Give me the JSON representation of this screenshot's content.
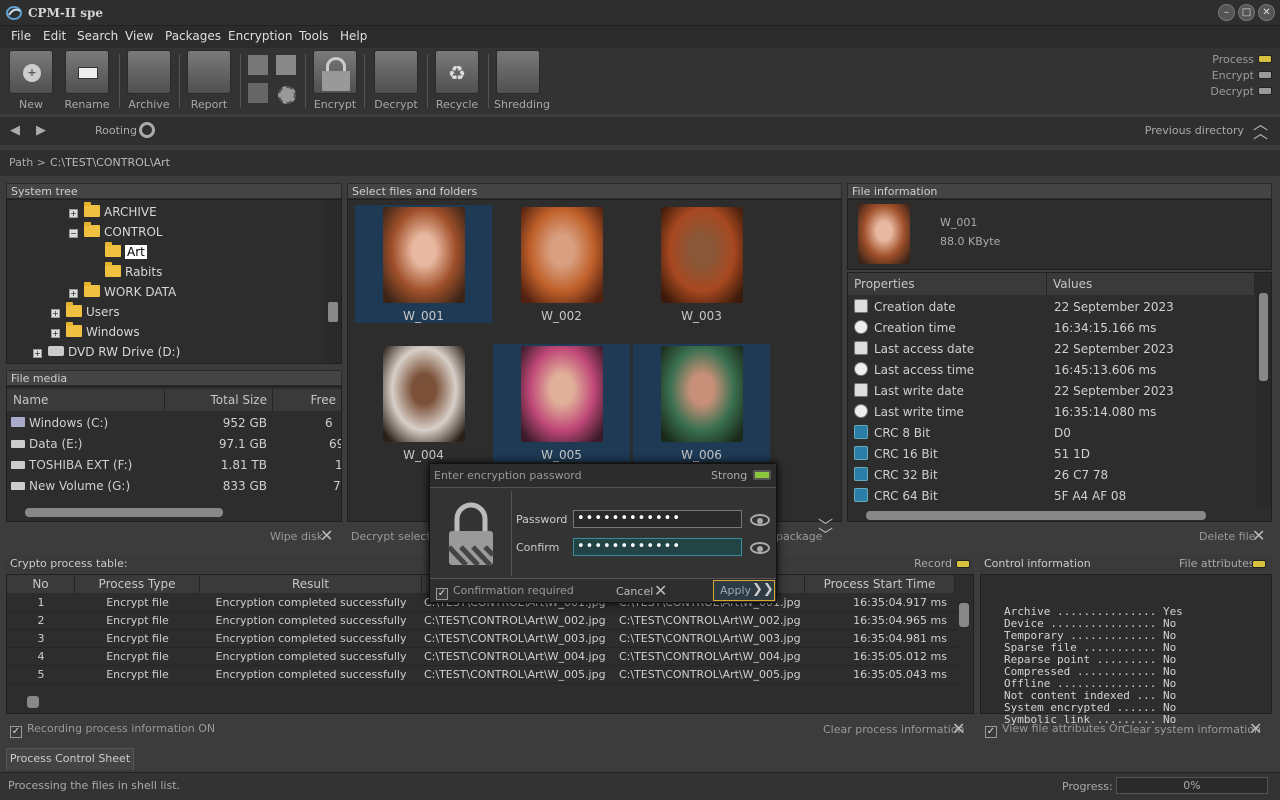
{
  "app": {
    "title": "CPM-II spe"
  },
  "menu": [
    "File",
    "Edit",
    "Search",
    "View",
    "Packages",
    "Encryption",
    "Tools",
    "Help"
  ],
  "toolbar": {
    "new": "New",
    "rename": "Rename",
    "archive": "Archive",
    "report": "Report",
    "encrypt": "Encrypt",
    "decrypt": "Decrypt",
    "recycle": "Recycle",
    "shredding": "Shredding"
  },
  "status_indicators": {
    "process": "Process",
    "encrypt": "Encrypt",
    "decrypt": "Decrypt",
    "colors": {
      "active": "#d8c040",
      "inactive": "#9a9a9a"
    }
  },
  "nav": {
    "rooting": "Rooting",
    "previous": "Previous directory"
  },
  "path": {
    "label": "Path >",
    "value": "C:\\TEST\\CONTROL\\Art"
  },
  "system_tree": {
    "title": "System tree",
    "items": [
      "ARCHIVE",
      "CONTROL",
      "Art",
      "Rabits",
      "WORK DATA",
      "Users",
      "Windows",
      "DVD RW Drive (D:)"
    ]
  },
  "file_media": {
    "title": "File media",
    "columns": [
      "Name",
      "Total Size",
      "Free"
    ],
    "rows": [
      {
        "name": "Windows  (C:)",
        "total": "952 GB",
        "free": "6"
      },
      {
        "name": "Data (E:)",
        "total": "97.1 GB",
        "free": "69"
      },
      {
        "name": "TOSHIBA EXT (F:)",
        "total": "1.81 TB",
        "free": "1."
      },
      {
        "name": "New Volume (G:)",
        "total": "833 GB",
        "free": "7"
      }
    ],
    "wipe": "Wipe disk"
  },
  "files": {
    "title": "Select files and folders",
    "items": [
      "W_001",
      "W_002",
      "W_003",
      "W_004",
      "W_005",
      "W_006"
    ],
    "decrypt_selected": "Decrypt selected",
    "package": "package"
  },
  "file_info": {
    "title": "File information",
    "name": "W_001",
    "size": "88.0 KByte",
    "columns": [
      "Properties",
      "Values"
    ],
    "rows": [
      {
        "p": "Creation date",
        "v": "22 September 2023"
      },
      {
        "p": "Creation time",
        "v": "16:34:15.166 ms"
      },
      {
        "p": "Last access date",
        "v": "22 September 2023"
      },
      {
        "p": "Last access time",
        "v": "16:45:13.606 ms"
      },
      {
        "p": "Last write date",
        "v": "22 September 2023"
      },
      {
        "p": "Last write time",
        "v": "16:35:14.080 ms"
      },
      {
        "p": "CRC 8 Bit",
        "v": "D0"
      },
      {
        "p": "CRC 16 Bit",
        "v": "51 1D"
      },
      {
        "p": "CRC 32 Bit",
        "v": "26 C7 78"
      },
      {
        "p": "CRC 64 Bit",
        "v": "5F A4 AF 08"
      }
    ],
    "delete": "Delete file"
  },
  "crypto": {
    "title": "Crypto process table:",
    "record": "Record",
    "columns": [
      "No",
      "Process Type",
      "Result",
      "",
      "",
      "Process Start Time"
    ],
    "rows": [
      {
        "no": "1",
        "type": "Encrypt file",
        "result": "Encryption completed successfully",
        "src": "C:\\TEST\\CONTROL\\Art\\W_001.jpg",
        "dst": "C:\\TEST\\CONTROL\\Art\\W_001.jpg",
        "time": "16:35:04.917 ms"
      },
      {
        "no": "2",
        "type": "Encrypt file",
        "result": "Encryption completed successfully",
        "src": "C:\\TEST\\CONTROL\\Art\\W_002.jpg",
        "dst": "C:\\TEST\\CONTROL\\Art\\W_002.jpg",
        "time": "16:35:04.965 ms"
      },
      {
        "no": "3",
        "type": "Encrypt file",
        "result": "Encryption completed successfully",
        "src": "C:\\TEST\\CONTROL\\Art\\W_003.jpg",
        "dst": "C:\\TEST\\CONTROL\\Art\\W_003.jpg",
        "time": "16:35:04.981 ms"
      },
      {
        "no": "4",
        "type": "Encrypt file",
        "result": "Encryption completed successfully",
        "src": "C:\\TEST\\CONTROL\\Art\\W_004.jpg",
        "dst": "C:\\TEST\\CONTROL\\Art\\W_004.jpg",
        "time": "16:35:05.012 ms"
      },
      {
        "no": "5",
        "type": "Encrypt file",
        "result": "Encryption completed successfully",
        "src": "C:\\TEST\\CONTROL\\Art\\W_005.jpg",
        "dst": "C:\\TEST\\CONTROL\\Art\\W_005.jpg",
        "time": "16:35:05.043 ms"
      }
    ],
    "recording": "Recording process information ON",
    "clear": "Clear process information"
  },
  "control": {
    "title": "Control information",
    "file_attributes": "File attributes",
    "lines": [
      "Archive ............... Yes",
      "Device ................ No",
      "Temporary ............. No",
      "Sparse file ........... No",
      "Reparse point ......... No",
      "Compressed ............ No",
      "Offline ............... No",
      "Not content indexed ... No",
      "System encrypted ...... No",
      "Symbolic link ......... No"
    ],
    "view_attr": "View file attributes On",
    "clear_sys": "Clear system information"
  },
  "dialog": {
    "placeholder": "Enter encryption password",
    "strength": "Strong",
    "password_label": "Password",
    "confirm_label": "Confirm",
    "password_value": "••••••••••••",
    "confirm_value": "••••••••••••",
    "confirmation": "Confirmation required",
    "cancel": "Cancel",
    "apply": "Apply"
  },
  "bottom": {
    "tab": "Process Control Sheet",
    "status": "Processing the files in shell list.",
    "progress_label": "Progress:",
    "progress": "0%"
  }
}
